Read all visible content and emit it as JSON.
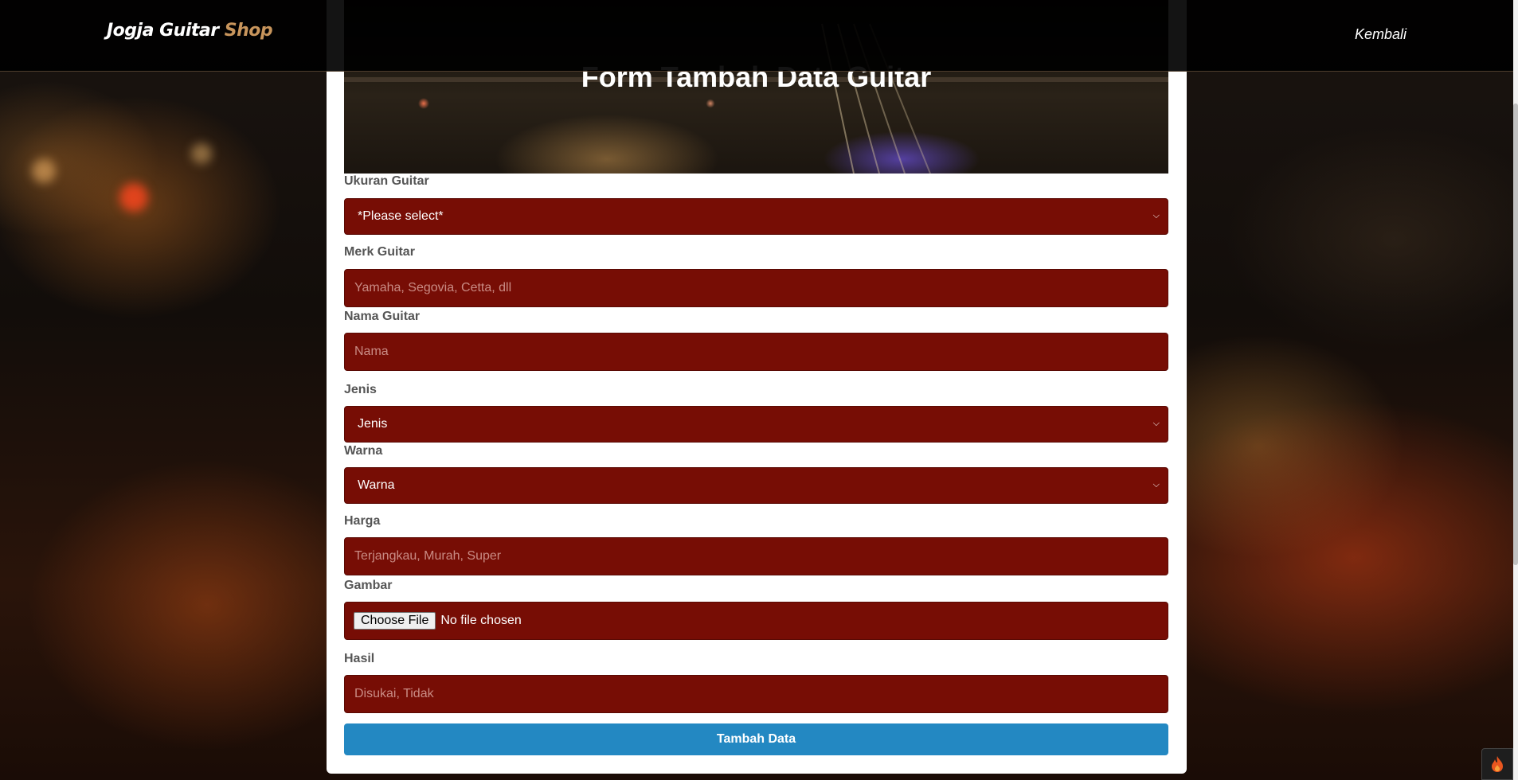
{
  "navbar": {
    "brand_main": "Jogja Guitar",
    "brand_accent": "Shop",
    "back_link": "Kembali"
  },
  "hero": {
    "title": "Form Tambah Data Guitar"
  },
  "form": {
    "ukuran": {
      "label": "Ukuran Guitar",
      "selected": "*Please select*"
    },
    "merk": {
      "label": "Merk Guitar",
      "placeholder": "Yamaha, Segovia, Cetta, dll"
    },
    "nama": {
      "label": "Nama Guitar",
      "placeholder": "Nama"
    },
    "jenis": {
      "label": "Jenis",
      "selected": "Jenis"
    },
    "warna": {
      "label": "Warna",
      "selected": "Warna"
    },
    "harga": {
      "label": "Harga",
      "placeholder": "Terjangkau, Murah, Super"
    },
    "gambar": {
      "label": "Gambar",
      "button": "Choose File",
      "status": "No file chosen"
    },
    "hasil": {
      "label": "Hasil",
      "placeholder": "Disukai, Tidak"
    },
    "submit": "Tambah Data"
  },
  "colors": {
    "field_bg": "#770d05",
    "submit_bg": "#2388c2",
    "brand_accent": "#c8955c",
    "label_text": "#555555"
  }
}
